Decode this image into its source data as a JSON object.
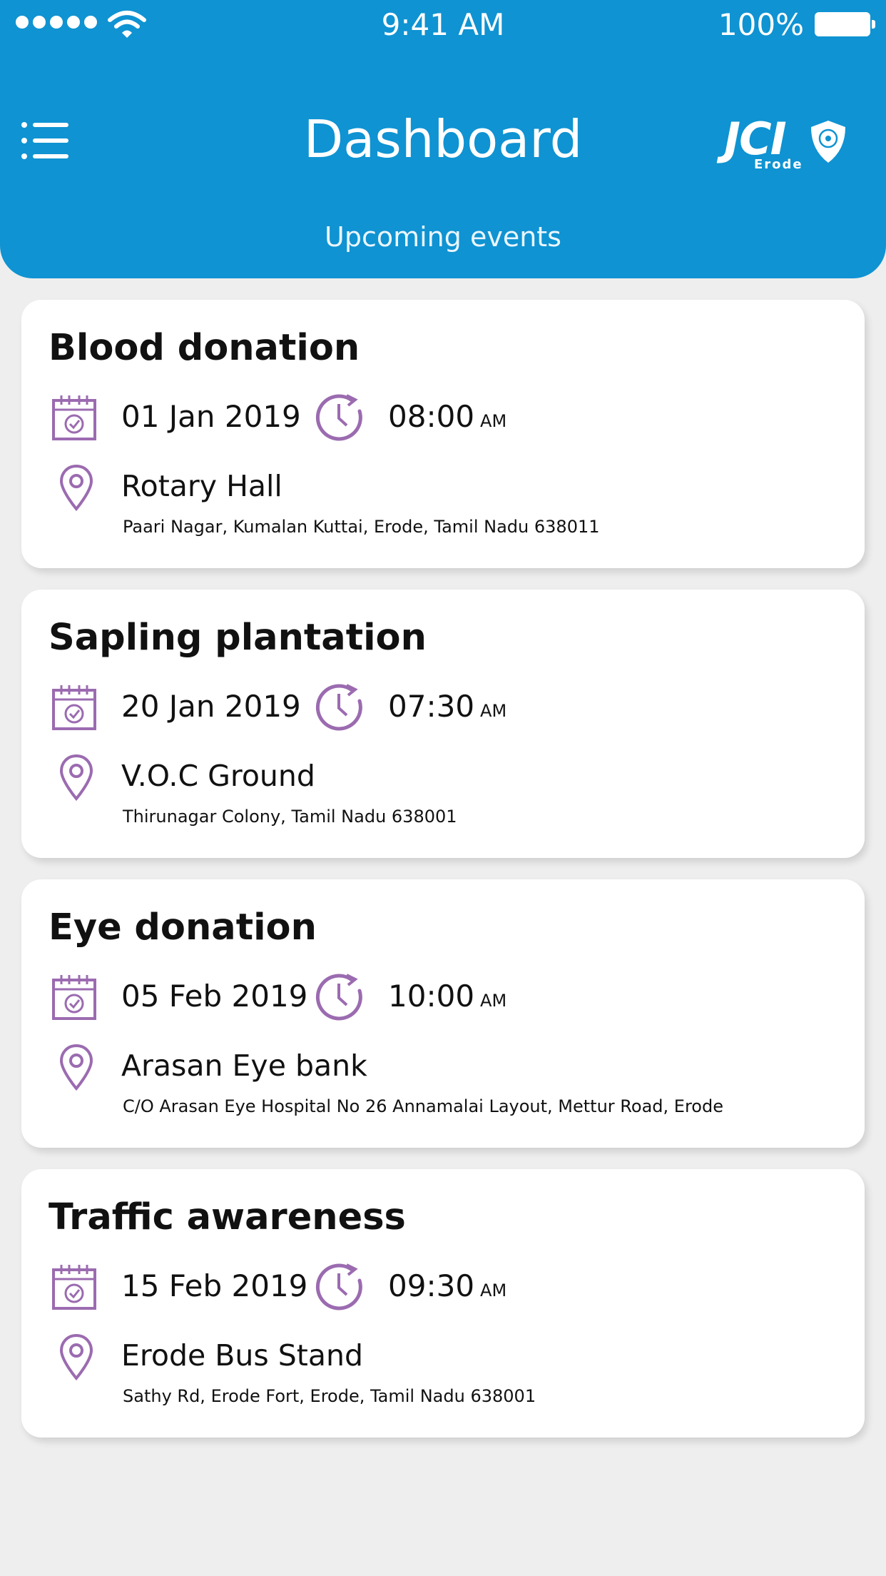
{
  "status_bar": {
    "time": "9:41 AM",
    "battery": "100%"
  },
  "header": {
    "title": "Dashboard",
    "subtitle": "Upcoming events",
    "logo_text": "JCI",
    "logo_sub": "Erode",
    "menu_icon": "hamburger-menu-icon",
    "bg_color": "#0f93d2"
  },
  "accent_color": "#9b6bb0",
  "events": [
    {
      "title": "Blood donation",
      "date": "01 Jan 2019",
      "time": "08:00",
      "ampm": "AM",
      "venue": "Rotary Hall",
      "address": "Paari Nagar, Kumalan Kuttai, Erode, Tamil Nadu 638011"
    },
    {
      "title": "Sapling plantation",
      "date": "20 Jan 2019",
      "time": "07:30",
      "ampm": "AM",
      "venue": "V.O.C Ground",
      "address": "Thirunagar Colony, Tamil Nadu 638001"
    },
    {
      "title": "Eye donation",
      "date": "05 Feb 2019",
      "time": "10:00",
      "ampm": "AM",
      "venue": "Arasan Eye bank",
      "address": "C/O Arasan Eye Hospital No 26 Annamalai Layout, Mettur Road, Erode"
    },
    {
      "title": "Traffic awareness",
      "date": "15 Feb 2019",
      "time": "09:30",
      "ampm": "AM",
      "venue": "Erode Bus Stand",
      "address": "Sathy Rd, Erode Fort, Erode, Tamil Nadu 638001"
    }
  ]
}
